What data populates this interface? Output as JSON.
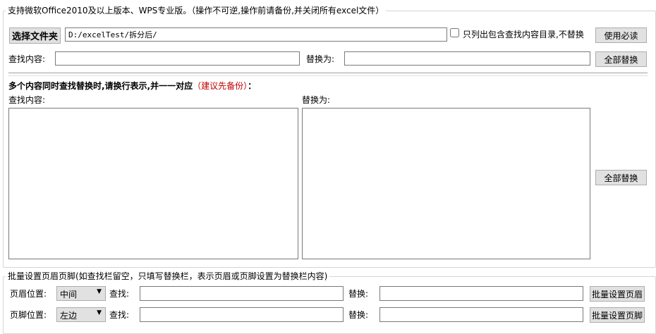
{
  "main_group": {
    "legend": "支持微软Office2010及以上版本、WPS专业版。（操作不可逆,操作前请备份,并关闭所有excel文件）",
    "choose_folder": "选择文件夹",
    "folder_path": "D:/excelTest/拆分后/",
    "only_list_label": "只列出包含查找内容目录,不替换",
    "readme": "使用必读",
    "find_label": "查找内容:",
    "replace_label": "替换为:",
    "replace_all": "全部替换",
    "multi_title": "多个内容同时查找替换时,请换行表示,并一一对应",
    "multi_note": "（建议先备份）",
    "multi_colon": "：",
    "multi_find_label": "查找内容:",
    "multi_replace_label": "替换为:",
    "multi_replace_all": "全部替换"
  },
  "header_footer": {
    "legend": "批量设置页眉页脚(如查找栏留空，只填写替换栏，表示页眉或页脚设置为替换栏内容)",
    "header_pos_label": "页眉位置:",
    "header_pos_value": "中间",
    "footer_pos_label": "页脚位置:",
    "footer_pos_value": "左边",
    "find_label": "查找:",
    "replace_label": "替换:",
    "set_header": "批量设置页眉",
    "set_footer": "批量设置页脚"
  },
  "colors": {
    "note_red": "#c00000"
  }
}
